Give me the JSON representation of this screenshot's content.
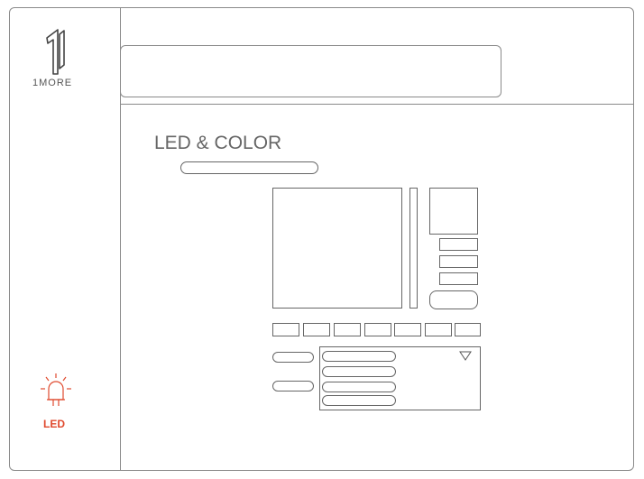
{
  "app": {
    "brand": "1MORE"
  },
  "page": {
    "title": "LED & COLOR"
  },
  "sidebar": {
    "items": [
      {
        "label": "LED",
        "icon": "led-bulb-icon",
        "active": true
      }
    ]
  },
  "colors": {
    "accent": "#e04a2e",
    "outline": "#666666",
    "frame": "#8a8a8a"
  },
  "swatches_count": 7,
  "preset_field_count": 4
}
